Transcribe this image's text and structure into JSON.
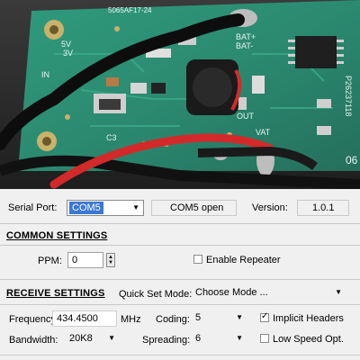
{
  "serial": {
    "label": "Serial Port:",
    "port_value": "COM5",
    "status": "COM5 open",
    "version_label": "Version:",
    "version_value": "1.0.1"
  },
  "common": {
    "title": "COMMON SETTINGS",
    "ppm_label": "PPM:",
    "ppm_value": "0",
    "repeater_label": "Enable Repeater",
    "repeater_checked": false
  },
  "receive": {
    "title": "RECEIVE SETTINGS",
    "quickset_label": "Quick Set Mode:",
    "quickset_value": "Choose Mode ...",
    "frequency_label": "Frequency:",
    "frequency_value": "434.4500",
    "frequency_unit": "MHz",
    "coding_label": "Coding:",
    "coding_value": "5",
    "implicit_label": "Implicit Headers",
    "implicit_checked": true,
    "bandwidth_label": "Bandwidth:",
    "bandwidth_value": "20K8",
    "spreading_label": "Spreading:",
    "spreading_value": "6",
    "lowspeed_label": "Low Speed Opt.",
    "lowspeed_checked": false
  },
  "pcb_text": {
    "a": "3V",
    "b": "5V",
    "c": "IN",
    "d": "C3",
    "e": "BAT-",
    "f": "BAT+",
    "g": "OUT",
    "h": "VAT",
    "i": "06",
    "j": "P26237118",
    "k": "5065AF17-24"
  }
}
